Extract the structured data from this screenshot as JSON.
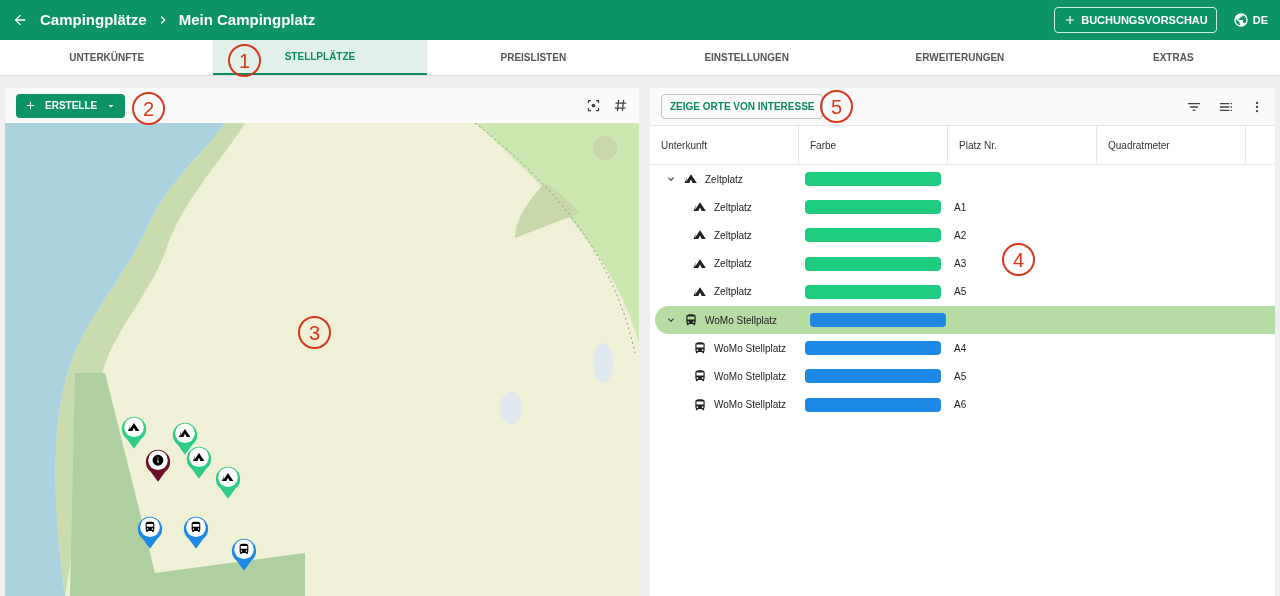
{
  "header": {
    "breadcrumb": [
      "Campingplätze",
      "Mein Campingplatz"
    ],
    "preview_button": "BUCHUNGSVORSCHAU",
    "language": "DE"
  },
  "tabs": [
    {
      "label": "UNTERKÜNFTE",
      "selected": false
    },
    {
      "label": "STELLPLÄTZE",
      "selected": true
    },
    {
      "label": "PREISLISTEN",
      "selected": false
    },
    {
      "label": "EINSTELLUNGEN",
      "selected": false
    },
    {
      "label": "ERWEITERUNGEN",
      "selected": false
    },
    {
      "label": "EXTRAS",
      "selected": false
    }
  ],
  "map_panel": {
    "create_button": "ERSTELLE",
    "markers": [
      {
        "kind": "tent",
        "color": "#2ecc87"
      },
      {
        "kind": "tent",
        "color": "#2ecc87"
      },
      {
        "kind": "info",
        "color": "#6b0f2a"
      },
      {
        "kind": "tent",
        "color": "#2ecc87"
      },
      {
        "kind": "tent",
        "color": "#2ecc87"
      },
      {
        "kind": "bus",
        "color": "#1e88e5"
      },
      {
        "kind": "bus",
        "color": "#1e88e5"
      },
      {
        "kind": "bus",
        "color": "#1e88e5"
      }
    ]
  },
  "table_panel": {
    "poi_button": "ZEIGE ORTE VON INTERESSE",
    "columns": [
      "Unterkunft",
      "Farbe",
      "Platz Nr.",
      "Quadratmeter"
    ],
    "groups": [
      {
        "kind": "tent",
        "name": "Zeltplatz",
        "color": "#1fcc7f",
        "expanded": true,
        "selected": false,
        "children": [
          {
            "name": "Zeltplatz",
            "color": "#1fcc7f",
            "number": "A1"
          },
          {
            "name": "Zeltplatz",
            "color": "#1fcc7f",
            "number": "A2"
          },
          {
            "name": "Zeltplatz",
            "color": "#1fcc7f",
            "number": "A3"
          },
          {
            "name": "Zeltplatz",
            "color": "#1fcc7f",
            "number": "A5"
          }
        ]
      },
      {
        "kind": "bus",
        "name": "WoMo Stellplatz",
        "color": "#1e88e5",
        "expanded": true,
        "selected": true,
        "children": [
          {
            "name": "WoMo Stellplatz",
            "color": "#1e88e5",
            "number": "A4"
          },
          {
            "name": "WoMo Stellplatz",
            "color": "#1e88e5",
            "number": "A5"
          },
          {
            "name": "WoMo Stellplatz",
            "color": "#1e88e5",
            "number": "A6"
          }
        ]
      }
    ]
  },
  "annotations": [
    "1",
    "2",
    "3",
    "4",
    "5"
  ]
}
